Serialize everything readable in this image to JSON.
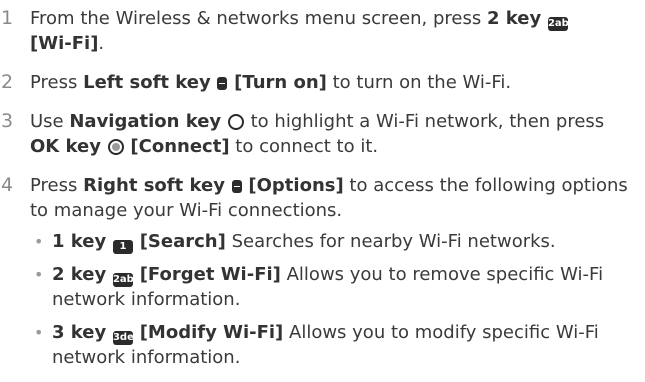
{
  "steps": [
    {
      "num": "1",
      "pre": "From the Wireless & networks menu screen, press ",
      "key": "2 key",
      "glyph": "2abc",
      "bracket": "[Wi-Fi]",
      "post": "."
    },
    {
      "num": "2",
      "pre": "Press ",
      "key": "Left soft key",
      "bracket": "[Turn on]",
      "post": " to turn on the Wi-Fi."
    },
    {
      "num": "3",
      "pre": "Use ",
      "key": "Navigation key",
      "mid": " to highlight a Wi-Fi network, then press ",
      "key2": "OK key",
      "bracket": "[Connect]",
      "post": " to connect to it."
    },
    {
      "num": "4",
      "pre": "Press ",
      "key": "Right soft key",
      "bracket": "[Options]",
      "post": " to access the following options to manage your Wi-Fi connections."
    }
  ],
  "bullets": [
    {
      "key": "1 key",
      "glyph": "1",
      "bracket": "[Search]",
      "desc": " Searches for nearby Wi-Fi networks."
    },
    {
      "key": "2 key",
      "glyph": "2abc",
      "bracket": "[Forget Wi-Fi]",
      "desc": " Allows you to remove specific Wi-Fi network information."
    },
    {
      "key": "3 key",
      "glyph": "3def",
      "bracket": "[Modify Wi-Fi]",
      "desc": " Allows you to modify specific Wi-Fi network information."
    }
  ],
  "icons": {
    "key_glyph": "keypad-key-icon",
    "soft_key": "soft-key-icon",
    "nav_key": "navigation-key-icon",
    "ok_key": "ok-key-icon",
    "bullet": "bullet-dot-icon"
  }
}
